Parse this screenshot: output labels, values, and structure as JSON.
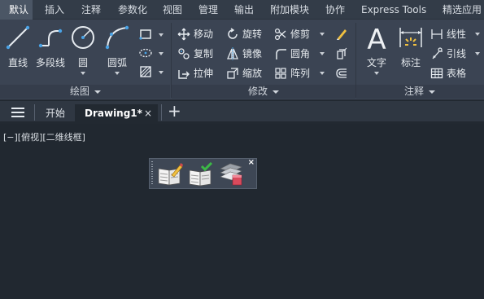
{
  "ribbon_tabs": [
    {
      "label": "默认",
      "active": true
    },
    {
      "label": "插入"
    },
    {
      "label": "注释"
    },
    {
      "label": "参数化"
    },
    {
      "label": "视图"
    },
    {
      "label": "管理"
    },
    {
      "label": "输出"
    },
    {
      "label": "附加模块"
    },
    {
      "label": "协作"
    },
    {
      "label": "Express Tools"
    },
    {
      "label": "精选应用"
    }
  ],
  "panels": {
    "draw": {
      "title": "绘图",
      "line": "直线",
      "polyline": "多段线",
      "circle": "圆",
      "arc": "圆弧"
    },
    "modify": {
      "title": "修改",
      "move": "移动",
      "rotate": "旋转",
      "trim": "修剪",
      "copy": "复制",
      "mirror": "镜像",
      "fillet": "圆角",
      "stretch": "拉伸",
      "scale": "缩放",
      "array": "阵列"
    },
    "annotation": {
      "title": "注释",
      "text": "文字",
      "dimension": "标注",
      "linear": "线性",
      "leader": "引线",
      "table": "表格"
    }
  },
  "doc_tabs": {
    "menu_icon": "hamburger-icon",
    "start": "开始",
    "drawing": "Drawing1*",
    "close": "×",
    "add": "+"
  },
  "viewport_label": "[−][俯视][二维线框]",
  "floating_toolbar": {
    "close": "×",
    "buttons": [
      "edit-notebook-icon",
      "check-notebook-icon",
      "layer-stack-icon"
    ]
  },
  "colors": {
    "accent": "#4aa3e6",
    "canvas": "#212830",
    "ribbon": "#3b4453"
  }
}
